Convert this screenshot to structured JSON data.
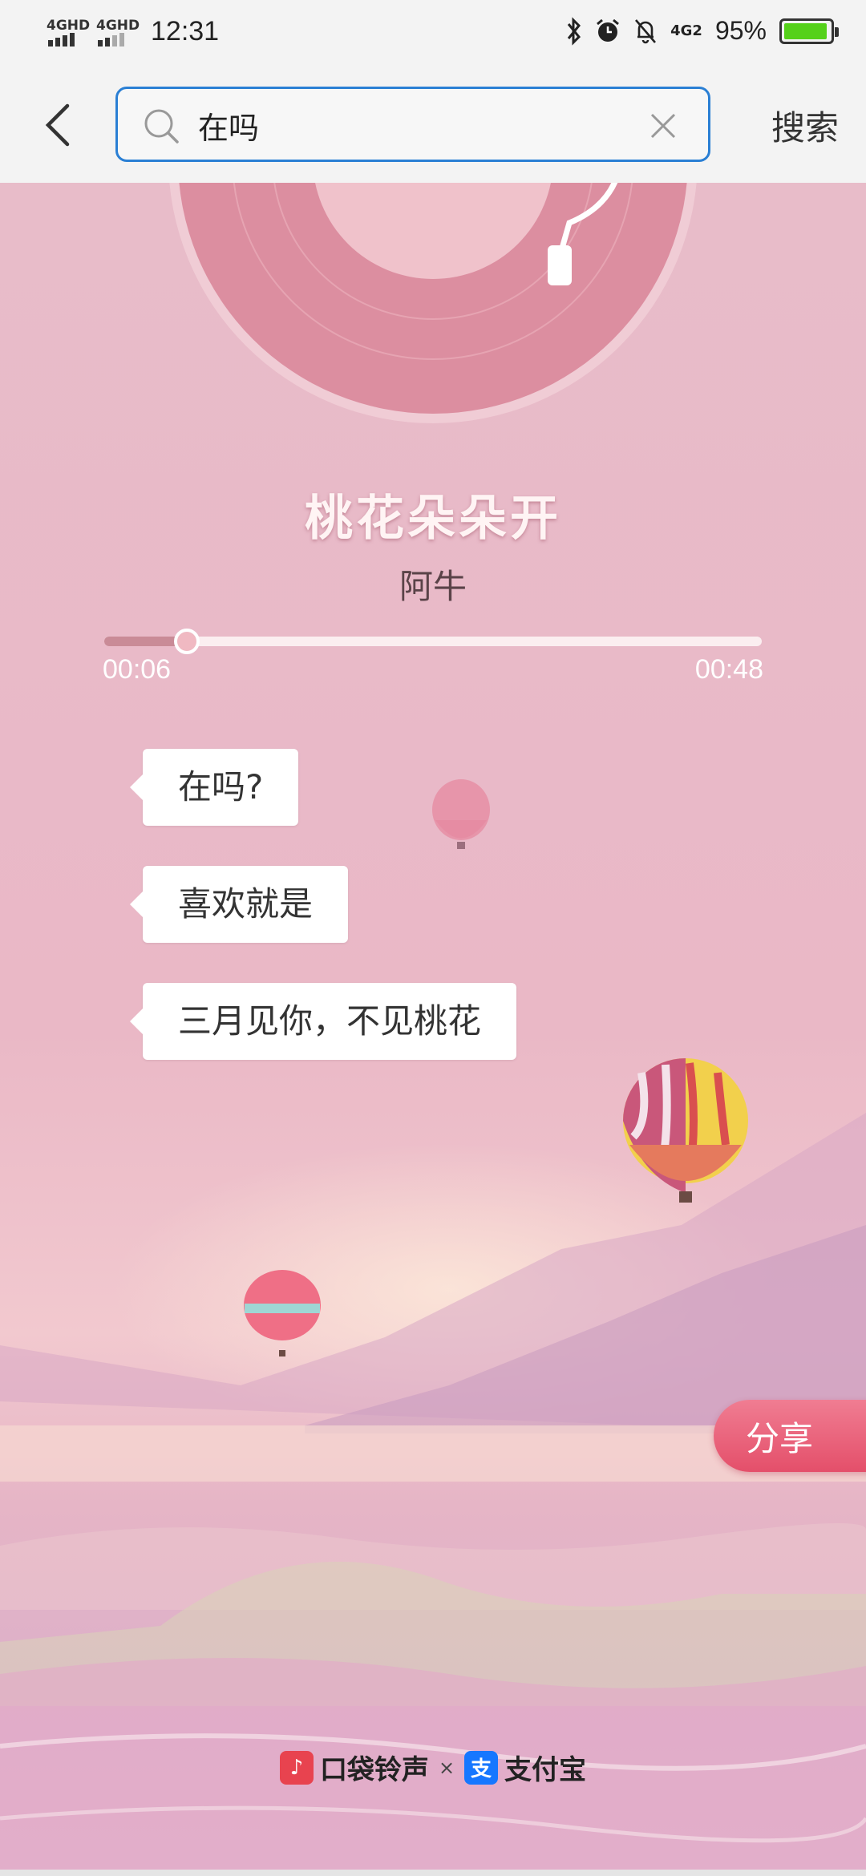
{
  "status_bar": {
    "network1": "4GHD",
    "network2": "4GHD",
    "time": "12:31",
    "battery_pct": "95%",
    "battery_level": 0.95,
    "mobile_label": "4G2"
  },
  "search": {
    "query": "在吗",
    "button_label": "搜索"
  },
  "player": {
    "song_title": "桃花朵朵开",
    "artist": "阿牛",
    "current_time": "00:06",
    "total_time": "00:48",
    "progress": 0.125
  },
  "chat": [
    {
      "text": "在吗?"
    },
    {
      "text": "喜欢就是"
    },
    {
      "text": "三月见你，不见桃花"
    }
  ],
  "share_label": "分享",
  "footer": {
    "brand1": "口袋铃声",
    "separator": "×",
    "brand2": "支付宝"
  },
  "colors": {
    "accent": "#2a7fd4",
    "share": "#e44f6a",
    "battery": "#55d11a"
  }
}
